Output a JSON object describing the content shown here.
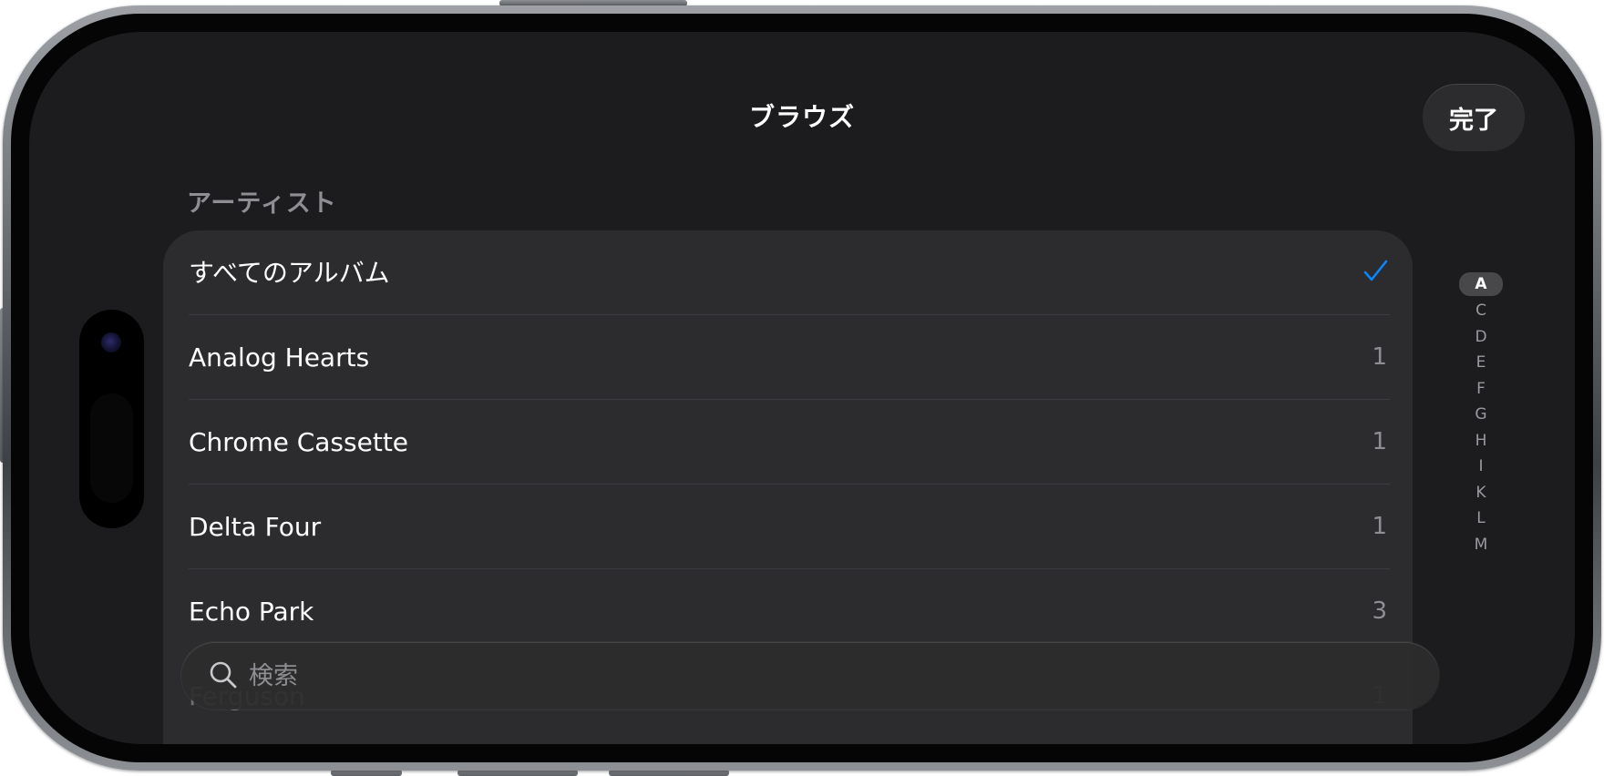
{
  "header": {
    "title": "ブラウズ",
    "done_label": "完了"
  },
  "section": {
    "title": "アーティスト"
  },
  "list": {
    "all_albums_label": "すべてのアルバム",
    "items": [
      {
        "label": "Analog Hearts",
        "count": "1"
      },
      {
        "label": "Chrome Cassette",
        "count": "1"
      },
      {
        "label": "Delta Four",
        "count": "1"
      },
      {
        "label": "Echo Park",
        "count": "3"
      },
      {
        "label": "Ferguson",
        "count": "1"
      }
    ]
  },
  "index": [
    "A",
    "C",
    "D",
    "E",
    "F",
    "G",
    "H",
    "I",
    "K",
    "L",
    "M"
  ],
  "search": {
    "placeholder": "検索"
  },
  "colors": {
    "accent": "#0a84ff",
    "background": "#1c1c1e",
    "card": "#2c2c2e"
  },
  "icons": {
    "selected": "checkmark-icon",
    "search": "magnifier-icon"
  }
}
